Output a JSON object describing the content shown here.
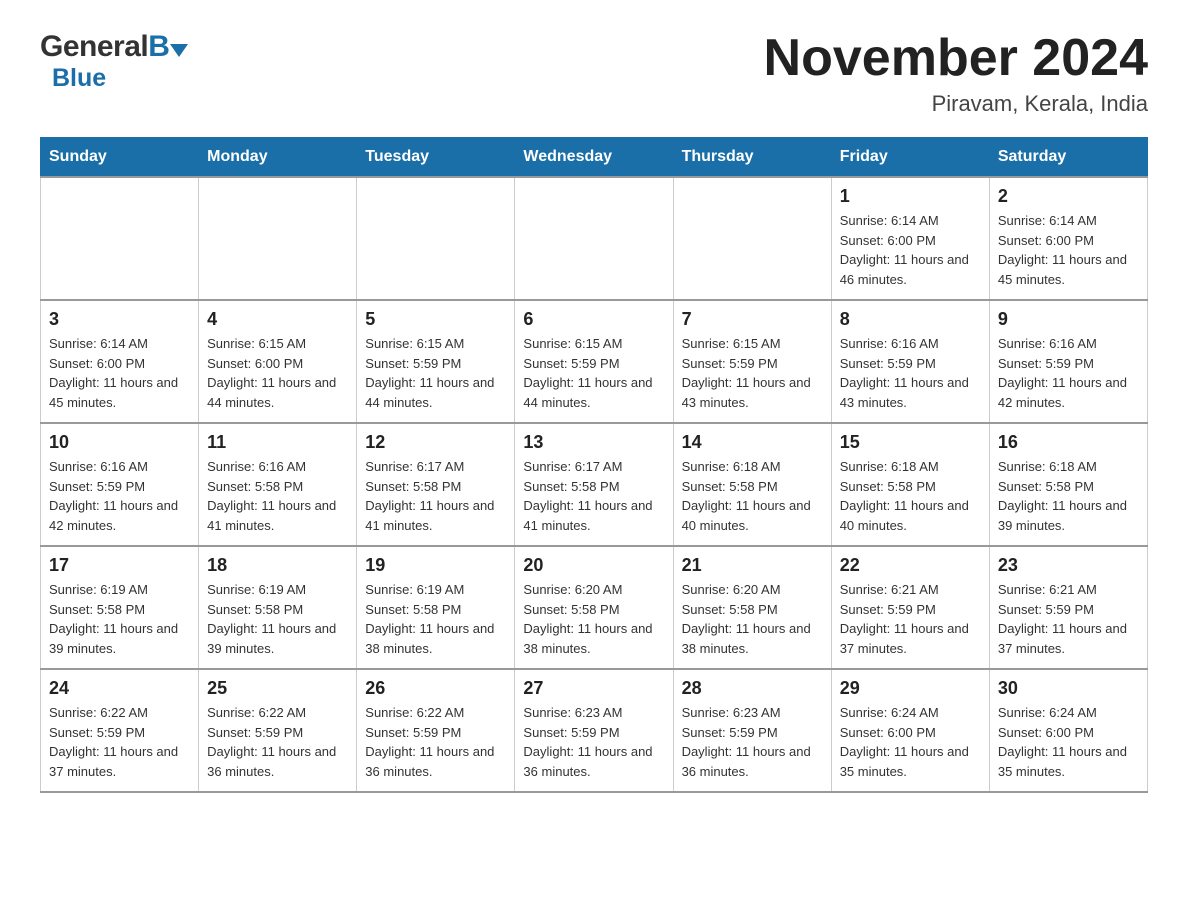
{
  "header": {
    "logo_general": "General",
    "logo_blue": "Blue",
    "month_title": "November 2024",
    "location": "Piravam, Kerala, India"
  },
  "calendar": {
    "days_of_week": [
      "Sunday",
      "Monday",
      "Tuesday",
      "Wednesday",
      "Thursday",
      "Friday",
      "Saturday"
    ],
    "weeks": [
      [
        {
          "day": "",
          "info": ""
        },
        {
          "day": "",
          "info": ""
        },
        {
          "day": "",
          "info": ""
        },
        {
          "day": "",
          "info": ""
        },
        {
          "day": "",
          "info": ""
        },
        {
          "day": "1",
          "info": "Sunrise: 6:14 AM\nSunset: 6:00 PM\nDaylight: 11 hours and 46 minutes."
        },
        {
          "day": "2",
          "info": "Sunrise: 6:14 AM\nSunset: 6:00 PM\nDaylight: 11 hours and 45 minutes."
        }
      ],
      [
        {
          "day": "3",
          "info": "Sunrise: 6:14 AM\nSunset: 6:00 PM\nDaylight: 11 hours and 45 minutes."
        },
        {
          "day": "4",
          "info": "Sunrise: 6:15 AM\nSunset: 6:00 PM\nDaylight: 11 hours and 44 minutes."
        },
        {
          "day": "5",
          "info": "Sunrise: 6:15 AM\nSunset: 5:59 PM\nDaylight: 11 hours and 44 minutes."
        },
        {
          "day": "6",
          "info": "Sunrise: 6:15 AM\nSunset: 5:59 PM\nDaylight: 11 hours and 44 minutes."
        },
        {
          "day": "7",
          "info": "Sunrise: 6:15 AM\nSunset: 5:59 PM\nDaylight: 11 hours and 43 minutes."
        },
        {
          "day": "8",
          "info": "Sunrise: 6:16 AM\nSunset: 5:59 PM\nDaylight: 11 hours and 43 minutes."
        },
        {
          "day": "9",
          "info": "Sunrise: 6:16 AM\nSunset: 5:59 PM\nDaylight: 11 hours and 42 minutes."
        }
      ],
      [
        {
          "day": "10",
          "info": "Sunrise: 6:16 AM\nSunset: 5:59 PM\nDaylight: 11 hours and 42 minutes."
        },
        {
          "day": "11",
          "info": "Sunrise: 6:16 AM\nSunset: 5:58 PM\nDaylight: 11 hours and 41 minutes."
        },
        {
          "day": "12",
          "info": "Sunrise: 6:17 AM\nSunset: 5:58 PM\nDaylight: 11 hours and 41 minutes."
        },
        {
          "day": "13",
          "info": "Sunrise: 6:17 AM\nSunset: 5:58 PM\nDaylight: 11 hours and 41 minutes."
        },
        {
          "day": "14",
          "info": "Sunrise: 6:18 AM\nSunset: 5:58 PM\nDaylight: 11 hours and 40 minutes."
        },
        {
          "day": "15",
          "info": "Sunrise: 6:18 AM\nSunset: 5:58 PM\nDaylight: 11 hours and 40 minutes."
        },
        {
          "day": "16",
          "info": "Sunrise: 6:18 AM\nSunset: 5:58 PM\nDaylight: 11 hours and 39 minutes."
        }
      ],
      [
        {
          "day": "17",
          "info": "Sunrise: 6:19 AM\nSunset: 5:58 PM\nDaylight: 11 hours and 39 minutes."
        },
        {
          "day": "18",
          "info": "Sunrise: 6:19 AM\nSunset: 5:58 PM\nDaylight: 11 hours and 39 minutes."
        },
        {
          "day": "19",
          "info": "Sunrise: 6:19 AM\nSunset: 5:58 PM\nDaylight: 11 hours and 38 minutes."
        },
        {
          "day": "20",
          "info": "Sunrise: 6:20 AM\nSunset: 5:58 PM\nDaylight: 11 hours and 38 minutes."
        },
        {
          "day": "21",
          "info": "Sunrise: 6:20 AM\nSunset: 5:58 PM\nDaylight: 11 hours and 38 minutes."
        },
        {
          "day": "22",
          "info": "Sunrise: 6:21 AM\nSunset: 5:59 PM\nDaylight: 11 hours and 37 minutes."
        },
        {
          "day": "23",
          "info": "Sunrise: 6:21 AM\nSunset: 5:59 PM\nDaylight: 11 hours and 37 minutes."
        }
      ],
      [
        {
          "day": "24",
          "info": "Sunrise: 6:22 AM\nSunset: 5:59 PM\nDaylight: 11 hours and 37 minutes."
        },
        {
          "day": "25",
          "info": "Sunrise: 6:22 AM\nSunset: 5:59 PM\nDaylight: 11 hours and 36 minutes."
        },
        {
          "day": "26",
          "info": "Sunrise: 6:22 AM\nSunset: 5:59 PM\nDaylight: 11 hours and 36 minutes."
        },
        {
          "day": "27",
          "info": "Sunrise: 6:23 AM\nSunset: 5:59 PM\nDaylight: 11 hours and 36 minutes."
        },
        {
          "day": "28",
          "info": "Sunrise: 6:23 AM\nSunset: 5:59 PM\nDaylight: 11 hours and 36 minutes."
        },
        {
          "day": "29",
          "info": "Sunrise: 6:24 AM\nSunset: 6:00 PM\nDaylight: 11 hours and 35 minutes."
        },
        {
          "day": "30",
          "info": "Sunrise: 6:24 AM\nSunset: 6:00 PM\nDaylight: 11 hours and 35 minutes."
        }
      ]
    ]
  }
}
